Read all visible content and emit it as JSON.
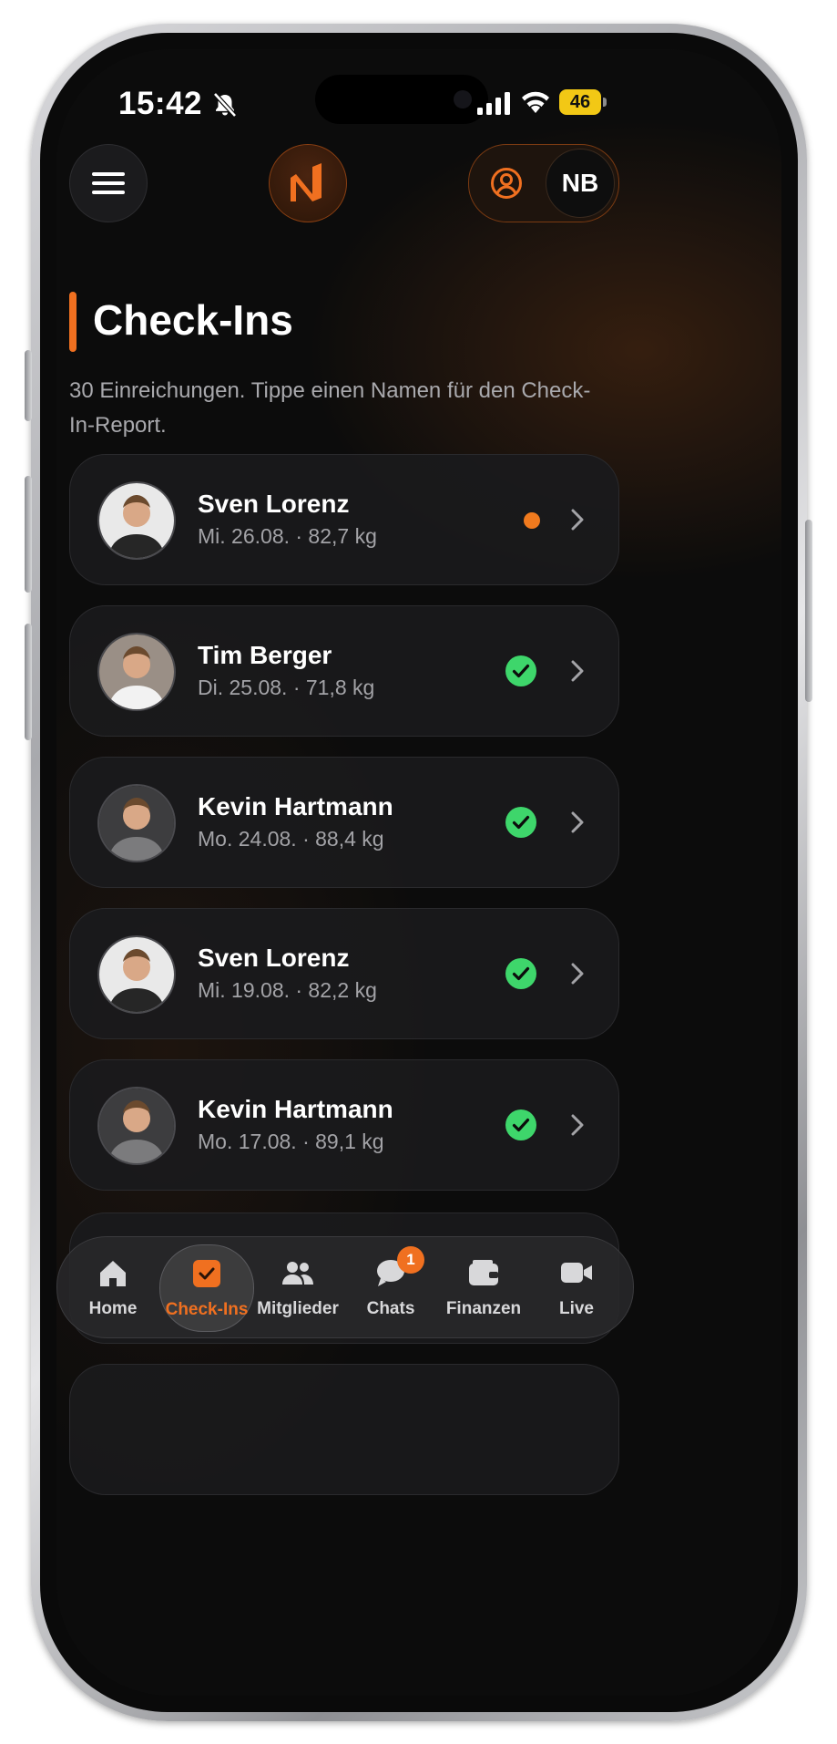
{
  "status_bar": {
    "time": "15:42",
    "battery": "46"
  },
  "header": {
    "initials": "NB"
  },
  "page": {
    "title": "Check-Ins",
    "subtitle": "30 Einreichungen. Tippe einen Namen für den Check-In-Report."
  },
  "checkins": [
    {
      "name": "Sven Lorenz",
      "meta": "Mi. 26.08. · 82,7 kg",
      "status": "pending"
    },
    {
      "name": "Tim Berger",
      "meta": "Di. 25.08. · 71,8 kg",
      "status": "done"
    },
    {
      "name": "Kevin Hartmann",
      "meta": "Mo. 24.08. · 88,4 kg",
      "status": "done"
    },
    {
      "name": "Sven Lorenz",
      "meta": "Mi. 19.08. · 82,2 kg",
      "status": "done"
    },
    {
      "name": "Kevin Hartmann",
      "meta": "Mo. 17.08. · 89,1 kg",
      "status": "done"
    }
  ],
  "tabbar": {
    "tabs": [
      {
        "label": "Home",
        "icon": "home-icon"
      },
      {
        "label": "Check-Ins",
        "icon": "checkin-icon",
        "active": true
      },
      {
        "label": "Mitglieder",
        "icon": "members-icon"
      },
      {
        "label": "Chats",
        "icon": "chat-icon",
        "badge": "1"
      },
      {
        "label": "Finanzen",
        "icon": "wallet-icon"
      },
      {
        "label": "Live",
        "icon": "video-icon"
      }
    ]
  },
  "colors": {
    "accent": "#f07020",
    "success": "#3ed66b",
    "pending": "#f07a1e",
    "background": "#0c0c0c",
    "card": "#1a1a1c"
  }
}
